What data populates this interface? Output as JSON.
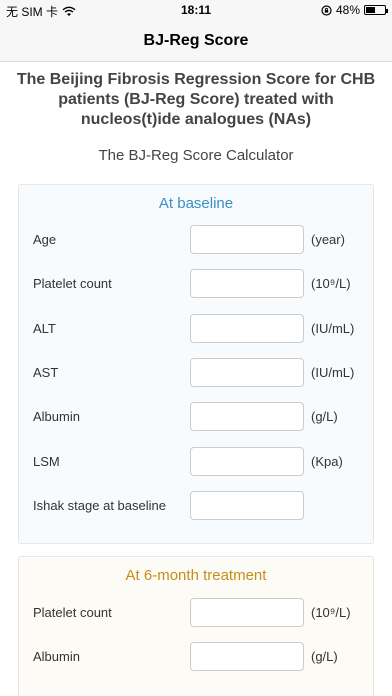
{
  "status_bar": {
    "carrier": "无 SIM 卡",
    "time": "18:11",
    "battery": "48%",
    "battery_level": 0.48
  },
  "nav": {
    "title": "BJ-Reg Score"
  },
  "heading": "The Beijing Fibrosis Regression Score for CHB patients (BJ-Reg Score) treated with nucleos(t)ide analogues (NAs)",
  "subheading": "The BJ-Reg Score Calculator",
  "baseline": {
    "title": "At baseline",
    "fields": [
      {
        "label": "Age",
        "unit": "(year)",
        "value": ""
      },
      {
        "label": "Platelet count",
        "unit": "(10⁹/L)",
        "value": ""
      },
      {
        "label": "ALT",
        "unit": "(IU/mL)",
        "value": ""
      },
      {
        "label": "AST",
        "unit": "(IU/mL)",
        "value": ""
      },
      {
        "label": "Albumin",
        "unit": "(g/L)",
        "value": ""
      },
      {
        "label": "LSM",
        "unit": "(Kpa)",
        "value": ""
      },
      {
        "label": "Ishak stage at baseline",
        "unit": "",
        "value": ""
      }
    ]
  },
  "six_month": {
    "title": "At 6-month treatment",
    "fields": [
      {
        "label": "Platelet count",
        "unit": "(10⁹/L)",
        "value": ""
      },
      {
        "label": "Albumin",
        "unit": "(g/L)",
        "value": ""
      }
    ]
  }
}
